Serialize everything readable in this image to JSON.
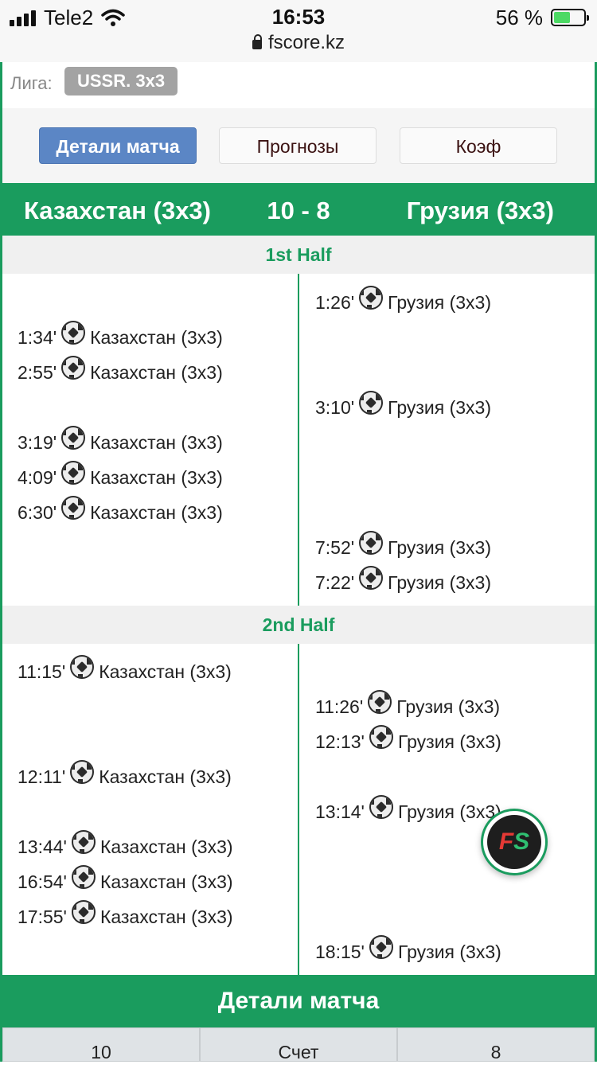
{
  "status_bar": {
    "carrier": "Tele2",
    "time": "16:53",
    "battery": "56 %",
    "battery_level": 0.56,
    "url": "fscore.kz"
  },
  "league": {
    "label": "Лига:",
    "value": "USSR. 3x3"
  },
  "tabs": [
    {
      "label": "Детали матча",
      "active": true
    },
    {
      "label": "Прогнозы"
    },
    {
      "label": "Коэф"
    }
  ],
  "match": {
    "home": "Казахстан (3x3)",
    "score": "10 - 8",
    "away": "Грузия (3x3)"
  },
  "halves": [
    {
      "title": "1st Half",
      "home_events": [
        {
          "time": "1:34'",
          "team": "Казахстан (3x3)"
        },
        {
          "time": "2:55'",
          "team": "Казахстан (3x3)"
        },
        {
          "time": "3:19'",
          "team": "Казахстан (3x3)"
        },
        {
          "time": "4:09'",
          "team": "Казахстан (3x3)"
        },
        {
          "time": "6:30'",
          "team": "Казахстан (3x3)"
        }
      ],
      "away_events": [
        {
          "time": "1:26'",
          "team": "Грузия (3x3)"
        },
        {
          "time": "3:10'",
          "team": "Грузия (3x3)"
        },
        {
          "time": "7:52'",
          "team": "Грузия (3x3)"
        },
        {
          "time": "7:22'",
          "team": "Грузия (3x3)"
        }
      ]
    },
    {
      "title": "2nd Half",
      "home_events": [
        {
          "time": "11:15'",
          "team": "Казахстан (3x3)"
        },
        {
          "time": "12:11'",
          "team": "Казахстан (3x3)"
        },
        {
          "time": "13:44'",
          "team": "Казахстан (3x3)"
        },
        {
          "time": "16:54'",
          "team": "Казахстан (3x3)"
        },
        {
          "time": "17:55'",
          "team": "Казахстан (3x3)"
        }
      ],
      "away_events": [
        {
          "time": "11:26'",
          "team": "Грузия (3x3)"
        },
        {
          "time": "12:13'",
          "team": "Грузия (3x3)"
        },
        {
          "time": "13:14'",
          "team": "Грузия (3x3)"
        },
        {
          "time": "18:15'",
          "team": "Грузия (3x3)"
        }
      ]
    }
  ],
  "fab": {
    "logo_left": "F",
    "logo_right": "S"
  },
  "details": {
    "title": "Детали матча",
    "row": {
      "home_value": "10",
      "label": "Счет",
      "away_value": "8"
    }
  },
  "colors": {
    "accent": "#1a9c5e",
    "tab_active": "#5b86c5",
    "badge": "#a3a3a3"
  }
}
